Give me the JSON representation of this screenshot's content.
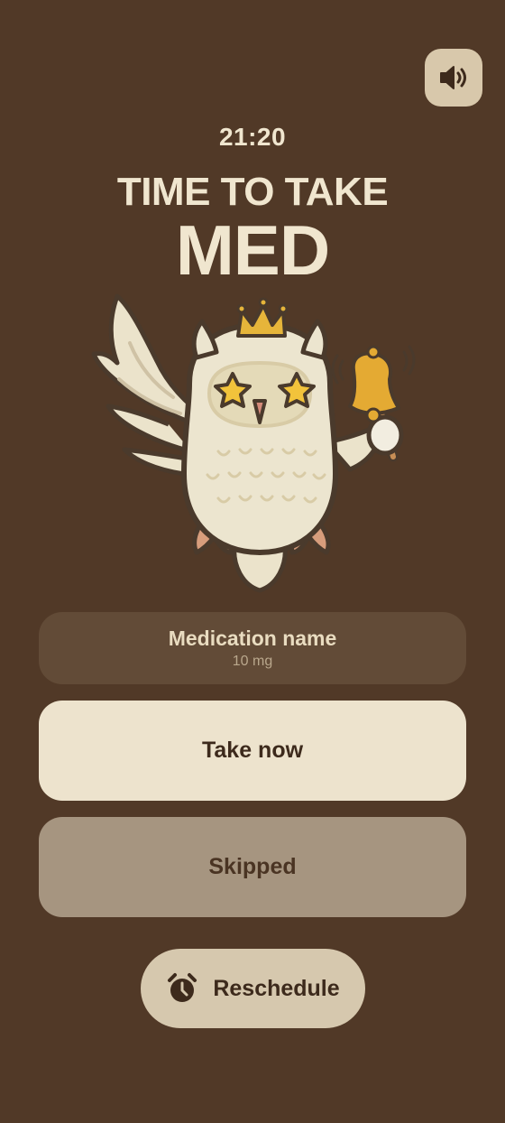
{
  "header": {
    "sound_button_icon": "speaker-icon"
  },
  "reminder": {
    "time": "21:20",
    "title_line1": "TIME TO TAKE",
    "title_line2": "MED"
  },
  "mascot": {
    "icon": "owl-with-crown-and-bell"
  },
  "medication": {
    "name": "Medication name",
    "dose": "10 mg"
  },
  "actions": {
    "take_label": "Take now",
    "skip_label": "Skipped",
    "reschedule_label": "Reschedule",
    "reschedule_icon": "alarm-clock-icon"
  },
  "colors": {
    "background": "#513927",
    "primary_button": "#ede3cd",
    "secondary_button": "#a69580",
    "card": "#624b37",
    "accent_gold": "#e6b53a"
  }
}
